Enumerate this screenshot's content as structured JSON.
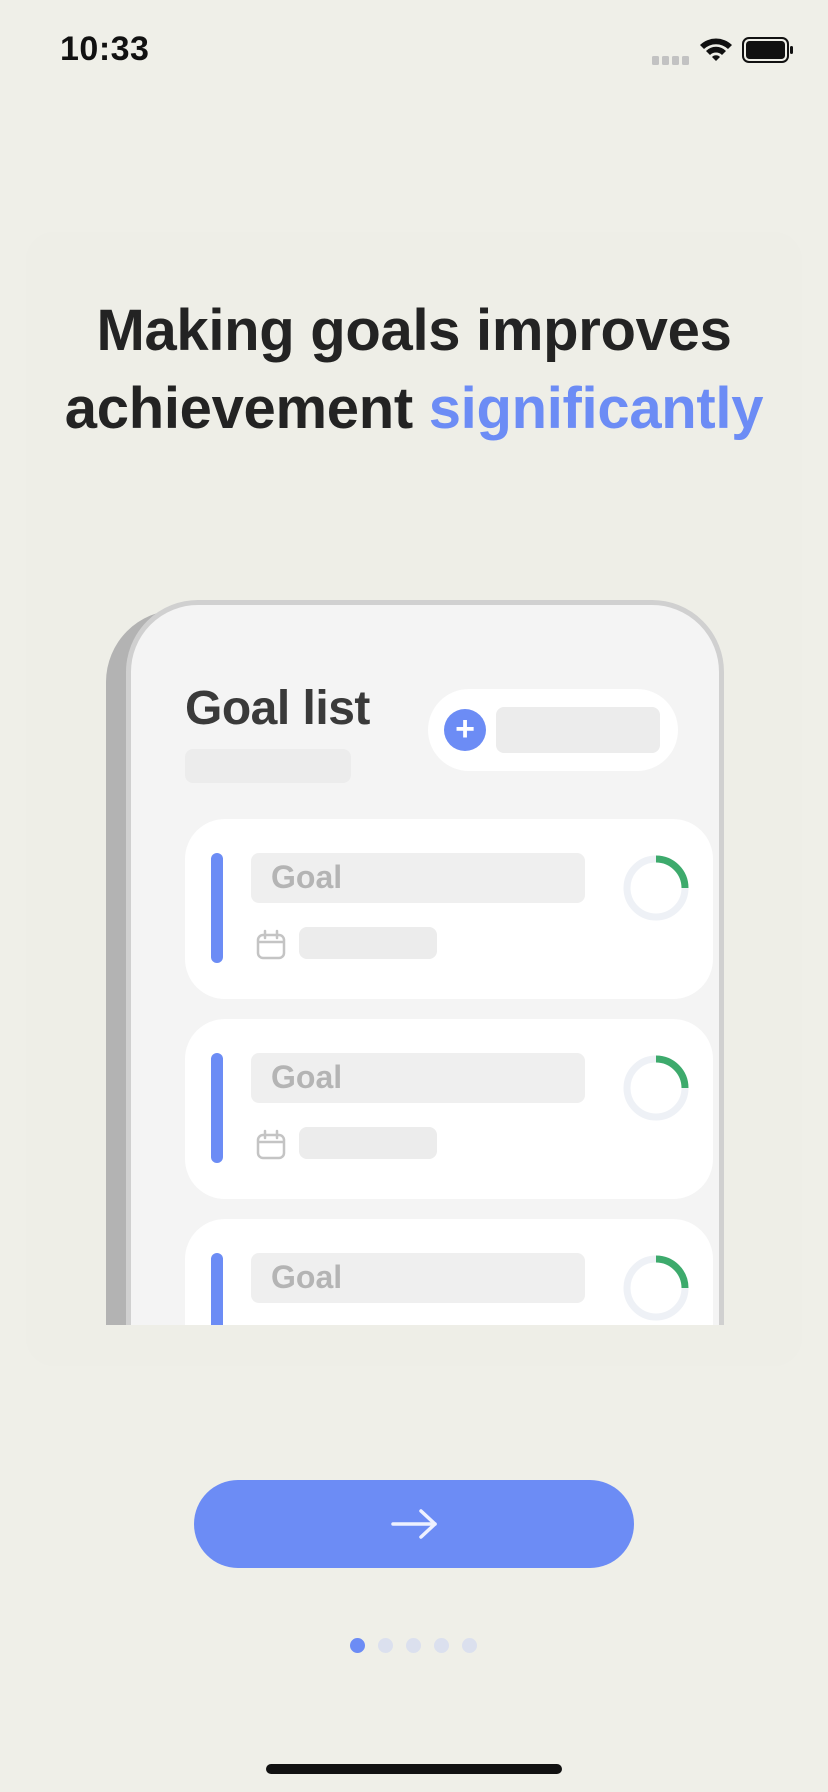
{
  "status_bar": {
    "time": "10:33"
  },
  "headline": {
    "line1": "Making goals improves",
    "line2_prefix": "achievement ",
    "accent": "significantly"
  },
  "mockup": {
    "title": "Goal list",
    "add_icon": "plus-icon",
    "goals": [
      {
        "label": "Goal",
        "progress": 0.25
      },
      {
        "label": "Goal",
        "progress": 0.25
      },
      {
        "label": "Goal",
        "progress": 0.25
      }
    ]
  },
  "next_button": {
    "icon": "arrow-right-icon"
  },
  "pagination": {
    "total": 5,
    "current": 1
  },
  "colors": {
    "accent": "#6c8cf5",
    "ring": "#3daa6c",
    "background": "#efefe8"
  }
}
